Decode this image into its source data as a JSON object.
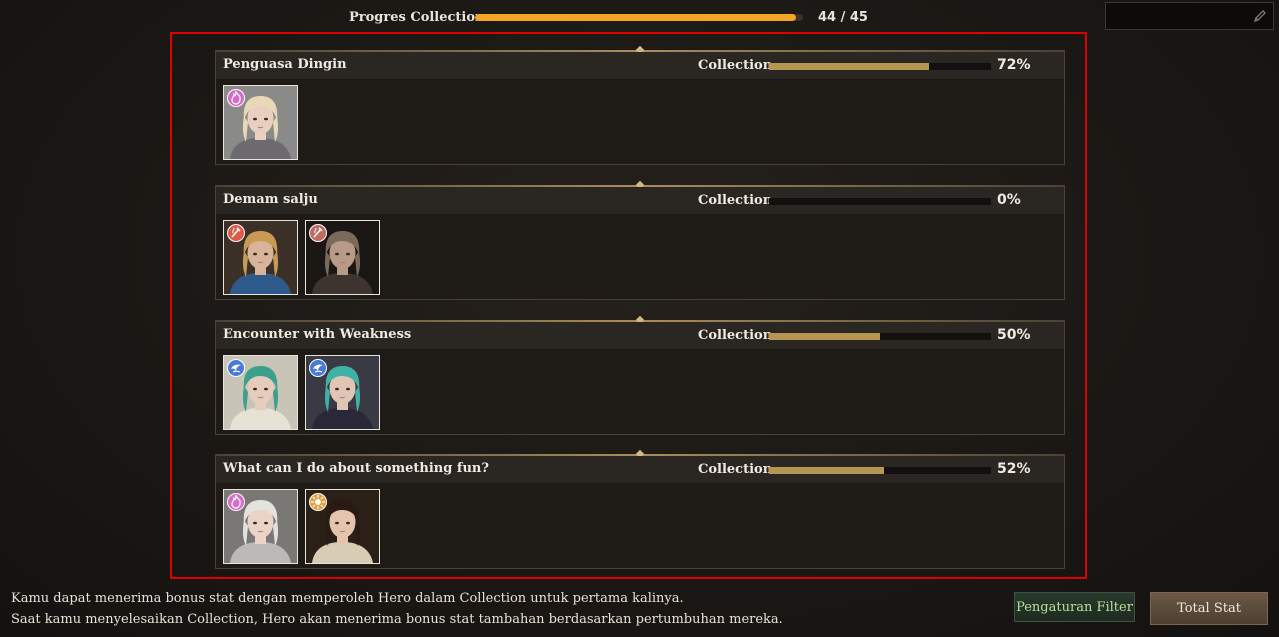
{
  "header": {
    "progress_label": "Progres Collection",
    "progress_count": "44 / 45",
    "progress_value": 0.978,
    "accent_color": "#f2a424"
  },
  "search": {
    "placeholder": "",
    "icon": "pencil-icon"
  },
  "collection_label": "Collection",
  "collections": [
    {
      "title": "Penguasa Dingin",
      "percent_label": "72%",
      "percent": 72,
      "heroes": [
        {
          "element": "fire",
          "element_color": "#d86ac8",
          "hair": "#e8d8b8",
          "bg": "#8a8a88",
          "skin": "#e8cfc0",
          "outfit": "#6d6a70"
        }
      ]
    },
    {
      "title": "Demam salju",
      "percent_label": "0%",
      "percent": 0,
      "heroes": [
        {
          "element": "flame-blade",
          "element_color": "#e05a4a",
          "hair": "#c89a52",
          "bg": "#3a3028",
          "skin": "#d8b49a",
          "outfit": "#2d5a8a"
        },
        {
          "element": "flame-blade",
          "element_color": "#c06a60",
          "hair": "#7a6a5a",
          "bg": "#1a1614",
          "skin": "#b89a86",
          "outfit": "#3d3430"
        }
      ]
    },
    {
      "title": "Encounter with Weakness",
      "percent_label": "50%",
      "percent": 50,
      "heroes": [
        {
          "element": "water",
          "element_color": "#4a7ad8",
          "hair": "#3aa08a",
          "bg": "#c8c4b8",
          "skin": "#e6ccbc",
          "outfit": "#e6e2d6"
        },
        {
          "element": "water",
          "element_color": "#4a7ad8",
          "hair": "#3fb2a6",
          "bg": "#3a3a44",
          "skin": "#e0c4b4",
          "outfit": "#2a2838"
        }
      ]
    },
    {
      "title": "What can I do about something fun?",
      "percent_label": "52%",
      "percent": 52,
      "heroes": [
        {
          "element": "fire",
          "element_color": "#d86ac8",
          "hair": "#e4e2de",
          "bg": "#7a7874",
          "skin": "#ead4c8",
          "outfit": "#bcbab6"
        },
        {
          "element": "light",
          "element_color": "#e0a040",
          "hair": "#2a1a14",
          "bg": "#2a2018",
          "skin": "#e4c4ac",
          "outfit": "#d8ccb4"
        }
      ]
    }
  ],
  "footer": {
    "line1": "Kamu dapat menerima bonus stat dengan memperoleh Hero dalam Collection untuk pertama kalinya.",
    "line2": "Saat kamu menyelesaikan Collection, Hero akan menerima bonus stat tambahan berdasarkan pertumbuhan mereka.",
    "filter_button": "Pengaturan Filter",
    "total_button": "Total Stat"
  }
}
